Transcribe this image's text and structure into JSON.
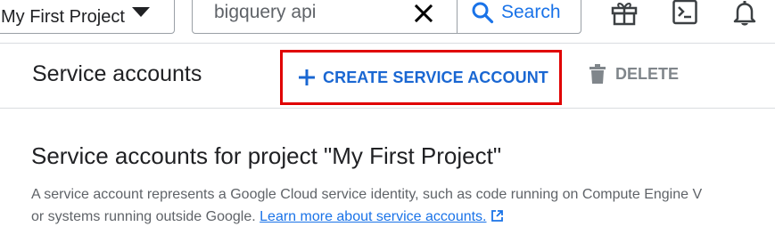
{
  "header": {
    "project_label": "My First Project",
    "search_value": "bigquery api",
    "search_button_label": "Search",
    "icons": [
      "gift-icon",
      "cloud-shell-icon",
      "notifications-icon"
    ]
  },
  "toolbar": {
    "title": "Service accounts",
    "create_label": "CREATE SERVICE ACCOUNT",
    "delete_label": "DELETE"
  },
  "content": {
    "heading": "Service accounts for project \"My First Project\"",
    "description_line1": "A service account represents a Google Cloud service identity, such as code running on Compute Engine V",
    "description_line2": "or systems running outside Google.",
    "learn_more_label": "Learn more about service accounts."
  },
  "colors": {
    "accent": "#1a73e8",
    "highlight_border": "#e00000",
    "muted": "#80868b"
  }
}
